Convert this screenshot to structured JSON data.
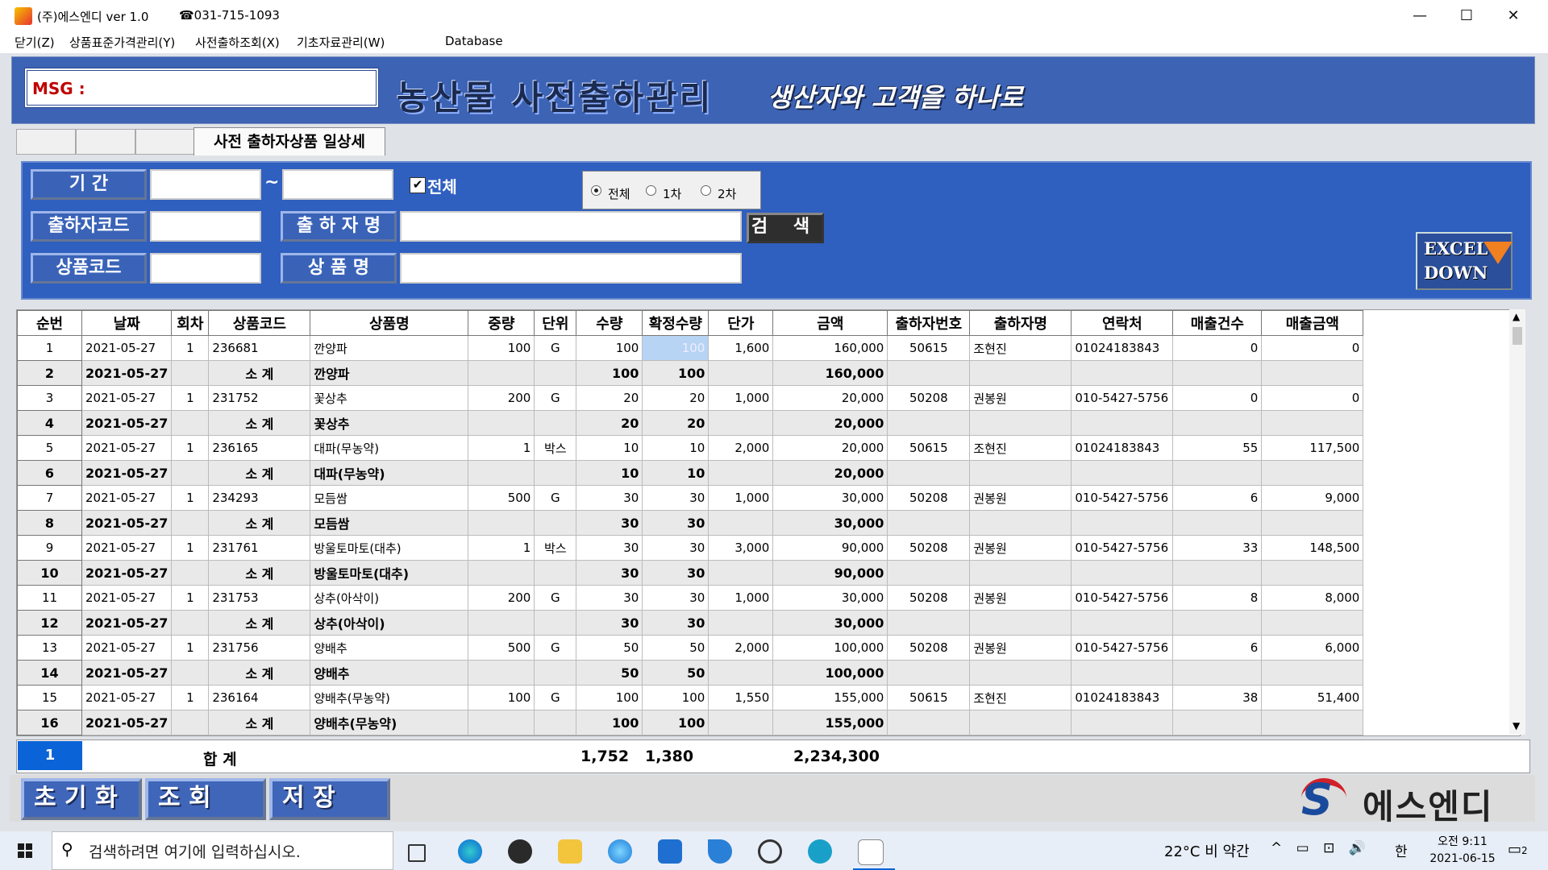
{
  "window": {
    "title": "(주)에스엔디  ver 1.0",
    "phone": "☎031-715-1093",
    "minimize": "—",
    "maximize": "☐",
    "close": "✕"
  },
  "menu": [
    "닫기(Z)",
    "상품표준가격관리(Y)",
    "사전출하조회(X)",
    "기초자료관리(W)",
    "Database"
  ],
  "header": {
    "msg_label": "MSG :",
    "title": "농산물 사전출하관리",
    "slogan": "생산자와 고객을 하나로"
  },
  "tabs": {
    "active": "사전 출하자상품 일상세"
  },
  "search": {
    "period_label": "기    간",
    "tilde": "~",
    "all_checkbox_label": "전체",
    "radio_options": [
      "전체",
      "1차",
      "2차"
    ],
    "radio_selected": "전체",
    "shipper_code_label": "출하자코드",
    "shipper_name_label": "출 하 자 명",
    "search_button": "검 색",
    "product_code_label": "상품코드",
    "product_name_label": "상  품  명",
    "excel_line1": "EXCEL",
    "excel_line2": "DOWN"
  },
  "grid": {
    "columns": [
      "순번",
      "날짜",
      "회차",
      "상품코드",
      "상품명",
      "중량",
      "단위",
      "수량",
      "확정수량",
      "단가",
      "금액",
      "출하자번호",
      "출하자명",
      "연락처",
      "매출건수",
      "매출금액"
    ],
    "rows": [
      {
        "type": "item",
        "cells": [
          "1",
          "2021-05-27",
          "1",
          "236681",
          "깐양파",
          "100",
          "G",
          "100",
          "100",
          "1,600",
          "160,000",
          "50615",
          "조현진",
          "01024183843",
          "0",
          "0"
        ]
      },
      {
        "type": "sub",
        "cells": [
          "2",
          "2021-05-27",
          "",
          "소 계",
          "깐양파",
          "",
          "",
          "100",
          "100",
          "",
          "160,000",
          "",
          "",
          "",
          "",
          ""
        ]
      },
      {
        "type": "item",
        "cells": [
          "3",
          "2021-05-27",
          "1",
          "231752",
          "꽃상추",
          "200",
          "G",
          "20",
          "20",
          "1,000",
          "20,000",
          "50208",
          "권봉원",
          "010-5427-5756",
          "0",
          "0"
        ]
      },
      {
        "type": "sub",
        "cells": [
          "4",
          "2021-05-27",
          "",
          "소 계",
          "꽃상추",
          "",
          "",
          "20",
          "20",
          "",
          "20,000",
          "",
          "",
          "",
          "",
          ""
        ]
      },
      {
        "type": "item",
        "cells": [
          "5",
          "2021-05-27",
          "1",
          "236165",
          "대파(무농약)",
          "1",
          "박스",
          "10",
          "10",
          "2,000",
          "20,000",
          "50615",
          "조현진",
          "01024183843",
          "55",
          "117,500"
        ]
      },
      {
        "type": "sub",
        "cells": [
          "6",
          "2021-05-27",
          "",
          "소 계",
          "대파(무농약)",
          "",
          "",
          "10",
          "10",
          "",
          "20,000",
          "",
          "",
          "",
          "",
          ""
        ]
      },
      {
        "type": "item",
        "cells": [
          "7",
          "2021-05-27",
          "1",
          "234293",
          "모듬쌈",
          "500",
          "G",
          "30",
          "30",
          "1,000",
          "30,000",
          "50208",
          "권봉원",
          "010-5427-5756",
          "6",
          "9,000"
        ]
      },
      {
        "type": "sub",
        "cells": [
          "8",
          "2021-05-27",
          "",
          "소 계",
          "모듬쌈",
          "",
          "",
          "30",
          "30",
          "",
          "30,000",
          "",
          "",
          "",
          "",
          ""
        ]
      },
      {
        "type": "item",
        "cells": [
          "9",
          "2021-05-27",
          "1",
          "231761",
          "방울토마토(대추)",
          "1",
          "박스",
          "30",
          "30",
          "3,000",
          "90,000",
          "50208",
          "권봉원",
          "010-5427-5756",
          "33",
          "148,500"
        ]
      },
      {
        "type": "sub",
        "cells": [
          "10",
          "2021-05-27",
          "",
          "소 계",
          "방울토마토(대추)",
          "",
          "",
          "30",
          "30",
          "",
          "90,000",
          "",
          "",
          "",
          "",
          ""
        ]
      },
      {
        "type": "item",
        "cells": [
          "11",
          "2021-05-27",
          "1",
          "231753",
          "상추(아삭이)",
          "200",
          "G",
          "30",
          "30",
          "1,000",
          "30,000",
          "50208",
          "권봉원",
          "010-5427-5756",
          "8",
          "8,000"
        ]
      },
      {
        "type": "sub",
        "cells": [
          "12",
          "2021-05-27",
          "",
          "소 계",
          "상추(아삭이)",
          "",
          "",
          "30",
          "30",
          "",
          "30,000",
          "",
          "",
          "",
          "",
          ""
        ]
      },
      {
        "type": "item",
        "cells": [
          "13",
          "2021-05-27",
          "1",
          "231756",
          "양배추",
          "500",
          "G",
          "50",
          "50",
          "2,000",
          "100,000",
          "50208",
          "권봉원",
          "010-5427-5756",
          "6",
          "6,000"
        ]
      },
      {
        "type": "sub",
        "cells": [
          "14",
          "2021-05-27",
          "",
          "소 계",
          "양배추",
          "",
          "",
          "50",
          "50",
          "",
          "100,000",
          "",
          "",
          "",
          "",
          ""
        ]
      },
      {
        "type": "item",
        "cells": [
          "15",
          "2021-05-27",
          "1",
          "236164",
          "양배추(무농약)",
          "100",
          "G",
          "100",
          "100",
          "1,550",
          "155,000",
          "50615",
          "조현진",
          "01024183843",
          "38",
          "51,400"
        ]
      },
      {
        "type": "sub",
        "cells": [
          "16",
          "2021-05-27",
          "",
          "소 계",
          "양배추(무농약)",
          "",
          "",
          "100",
          "100",
          "",
          "155,000",
          "",
          "",
          "",
          "",
          ""
        ]
      }
    ]
  },
  "totals": {
    "row_no": "1",
    "label": "합 계",
    "quantity": "1,752",
    "confirmed_quantity": "1,380",
    "amount": "2,234,300"
  },
  "buttons": {
    "reset": "초 기 화",
    "query": "조    회",
    "save": "저    장"
  },
  "logo": {
    "mark": "S",
    "text": "에스엔디"
  },
  "taskbar": {
    "search_placeholder": "검색하려면 여기에 입력하십시오.",
    "weather": "22°C  비 약간",
    "tray": "^ ▭ ⊡ 🔊",
    "ime": "한",
    "time": "오전 9:11",
    "date": "2021-06-15",
    "notification_count": "2"
  },
  "colors": {
    "header_bg": "#3d63b5",
    "panel_bg": "#2f5fbf",
    "selected_row": "#0a64d8",
    "subtotal_bg": "#e9e9e9"
  }
}
